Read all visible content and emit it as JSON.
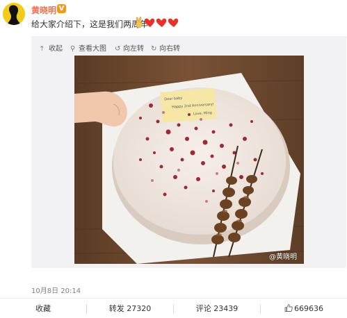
{
  "user": {
    "name": "黄晓明",
    "verified_badge": "V"
  },
  "post": {
    "text": "给大家介绍下，这是我们两周年",
    "emojis": [
      "victory-hand-icon",
      "heart-icon",
      "heart-icon",
      "heart-icon"
    ],
    "timestamp": "10月8日 20:14"
  },
  "media_toolbar": {
    "collapse": "收起",
    "view_large": "查看大图",
    "rotate_left": "向左转",
    "rotate_right": "向右转"
  },
  "photo": {
    "watermark": "@黄晓明"
  },
  "actions": {
    "favorite_label": "收藏",
    "repost_label": "转发",
    "repost_count": "27320",
    "comment_label": "评论",
    "comment_count": "23439",
    "like_count": "669636"
  },
  "colors": {
    "username": "#eb7350",
    "badge": "#f09a1d",
    "media_bg": "#f2f2f5",
    "heart": "#e8312a"
  }
}
